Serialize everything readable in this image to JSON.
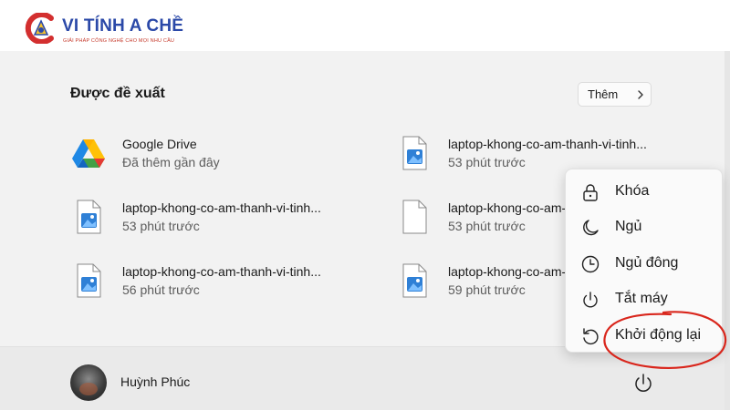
{
  "brand": {
    "name": "VI TÍNH A CHỀ",
    "tagline": "GIẢI PHÁP CÔNG NGHỆ CHO MỌI NHU CẦU"
  },
  "recommended": {
    "title": "Được đề xuất",
    "more_label": "Thêm",
    "items": [
      {
        "name": "Google Drive",
        "sub": "Đã thêm gần đây",
        "icon": "google-drive-icon"
      },
      {
        "name": "laptop-khong-co-am-thanh-vi-tinh...",
        "sub": "53 phút trước",
        "icon": "image-file-icon"
      },
      {
        "name": "laptop-khong-co-am-thanh-vi-tinh...",
        "sub": "53 phút trước",
        "icon": "image-file-icon"
      },
      {
        "name": "laptop-khong-co-am-thanh-vi-tinh...",
        "sub": "53 phút trước",
        "icon": "blank-file-icon"
      },
      {
        "name": "laptop-khong-co-am-thanh-vi-tinh...",
        "sub": "56 phút trước",
        "icon": "image-file-icon"
      },
      {
        "name": "laptop-khong-co-am-thanh-vi-tinh...",
        "sub": "59 phút trước",
        "icon": "image-file-icon"
      }
    ]
  },
  "user": {
    "name": "Huỳnh Phúc"
  },
  "power_menu": {
    "items": [
      {
        "label": "Khóa",
        "icon": "lock-icon"
      },
      {
        "label": "Ngủ",
        "icon": "moon-icon"
      },
      {
        "label": "Ngủ đông",
        "icon": "clock-icon"
      },
      {
        "label": "Tắt máy",
        "icon": "power-icon"
      },
      {
        "label": "Khởi động lại",
        "icon": "restart-icon"
      }
    ]
  },
  "colors": {
    "brand_blue": "#2b49a8",
    "brand_red": "#c63a2c",
    "annotation_red": "#d9261c",
    "panel_bg": "#f2f2f2"
  }
}
